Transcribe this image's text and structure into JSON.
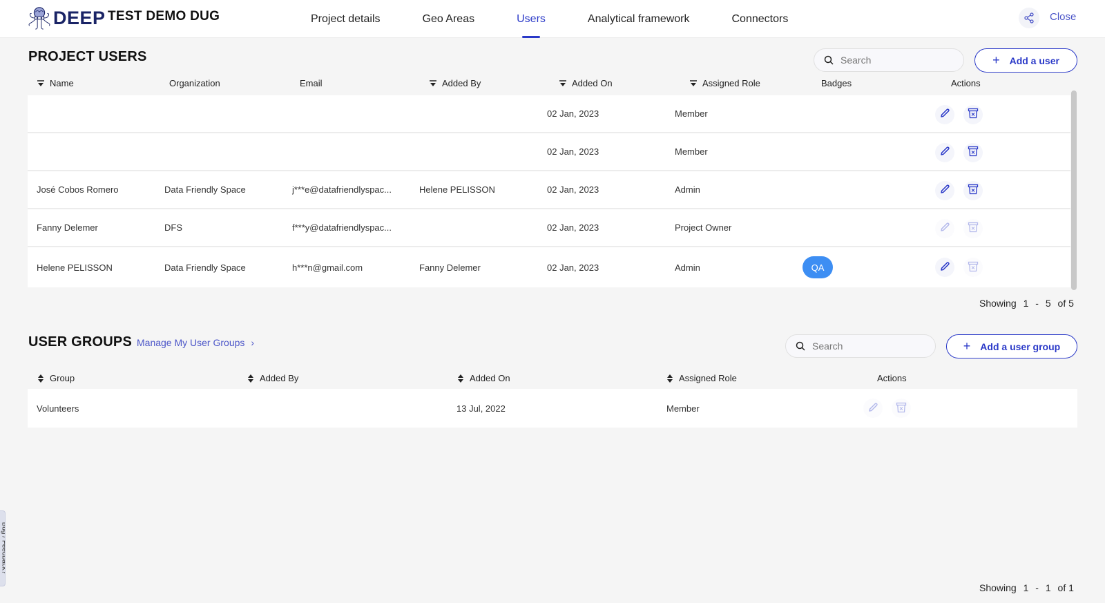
{
  "app": {
    "logo_text": "DEEP",
    "project_name": "TEST DEMO DUG",
    "close_label": "Close",
    "feedback_label": "Bug / Feedback?"
  },
  "nav": {
    "tabs": [
      {
        "label": "Project details",
        "active": false
      },
      {
        "label": "Geo Areas",
        "active": false
      },
      {
        "label": "Users",
        "active": true
      },
      {
        "label": "Analytical framework",
        "active": false
      },
      {
        "label": "Connectors",
        "active": false
      }
    ]
  },
  "colors": {
    "accent": "#2a39c8",
    "badge": "#3d8ef3",
    "brand": "#1a2466"
  },
  "project_users": {
    "title": "PROJECT USERS",
    "search_placeholder": "Search",
    "add_label": "Add a user",
    "columns": [
      {
        "label": "Name",
        "sortable": true
      },
      {
        "label": "Organization",
        "sortable": false
      },
      {
        "label": "Email",
        "sortable": false
      },
      {
        "label": "Added By",
        "sortable": true
      },
      {
        "label": "Added On",
        "sortable": true
      },
      {
        "label": "Assigned Role",
        "sortable": true
      },
      {
        "label": "Badges",
        "sortable": false
      },
      {
        "label": "Actions",
        "sortable": false
      }
    ],
    "rows": [
      {
        "name": "",
        "organization": "",
        "email": "",
        "added_by": "",
        "added_on": "02 Jan, 2023",
        "role": "Member",
        "badge": "",
        "edit_enabled": true,
        "delete_enabled": true
      },
      {
        "name": "",
        "organization": "",
        "email": "",
        "added_by": "",
        "added_on": "02 Jan, 2023",
        "role": "Member",
        "badge": "",
        "edit_enabled": true,
        "delete_enabled": true
      },
      {
        "name": "José Cobos Romero",
        "organization": "Data Friendly Space",
        "email": "j***e@datafriendlyspac...",
        "added_by": "Helene PELISSON",
        "added_on": "02 Jan, 2023",
        "role": "Admin",
        "badge": "",
        "edit_enabled": true,
        "delete_enabled": true
      },
      {
        "name": "Fanny Delemer",
        "organization": "DFS",
        "email": "f***y@datafriendlyspac...",
        "added_by": "",
        "added_on": "02 Jan, 2023",
        "role": "Project Owner",
        "badge": "",
        "edit_enabled": false,
        "delete_enabled": false
      },
      {
        "name": "Helene PELISSON",
        "organization": "Data Friendly Space",
        "email": "h***n@gmail.com",
        "added_by": "Fanny Delemer",
        "added_on": "02 Jan, 2023",
        "role": "Admin",
        "badge": "QA",
        "edit_enabled": true,
        "delete_enabled": false
      }
    ],
    "pager": {
      "label": "Showing",
      "from": "1",
      "sep": "-",
      "to": "5",
      "of": "of 5"
    }
  },
  "user_groups": {
    "title": "USER GROUPS",
    "manage_link": "Manage My User Groups",
    "search_placeholder": "Search",
    "add_label": "Add a user group",
    "columns": [
      {
        "label": "Group",
        "sortable": true
      },
      {
        "label": "Added By",
        "sortable": true
      },
      {
        "label": "Added On",
        "sortable": true
      },
      {
        "label": "Assigned Role",
        "sortable": true
      },
      {
        "label": "Actions",
        "sortable": false
      }
    ],
    "rows": [
      {
        "group": "Volunteers",
        "added_by": "",
        "added_on": "13 Jul, 2022",
        "role": "Member",
        "edit_enabled": false,
        "delete_enabled": false
      }
    ],
    "pager": {
      "label": "Showing",
      "from": "1",
      "sep": "-",
      "to": "1",
      "of": "of 1"
    }
  }
}
